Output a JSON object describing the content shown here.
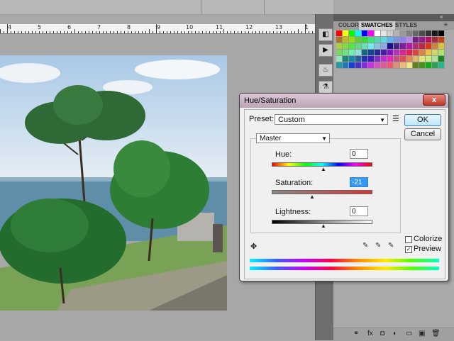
{
  "ruler": {
    "labels": [
      "4",
      "5",
      "6",
      "7",
      "8",
      "9",
      "10",
      "11",
      "12",
      "13"
    ]
  },
  "panel": {
    "tabs": [
      "COLOR",
      "SWATCHES",
      "STYLES"
    ],
    "active_tab": "SWATCHES",
    "bottom_icons": [
      "link-icon",
      "fx-icon",
      "mask-icon",
      "adjustment-icon",
      "folder-icon",
      "new-layer-icon",
      "trash-icon"
    ]
  },
  "dialog": {
    "title": "Hue/Saturation",
    "close_label": "x",
    "preset_label": "Preset:",
    "preset_value": "Custom",
    "ok_label": "OK",
    "cancel_label": "Cancel",
    "channel_value": "Master",
    "hue_label": "Hue:",
    "hue_value": "0",
    "saturation_label": "Saturation:",
    "saturation_value": "-21",
    "lightness_label": "Lightness:",
    "lightness_value": "0",
    "colorize_label": "Colorize",
    "colorize_checked": false,
    "preview_label": "Preview",
    "preview_checked": true
  },
  "colors": {
    "dialog_title_gradient": [
      "#dcc8d8",
      "#b9a5b6"
    ],
    "close_button": "#c4382a",
    "selection_highlight": "#3399ff"
  }
}
